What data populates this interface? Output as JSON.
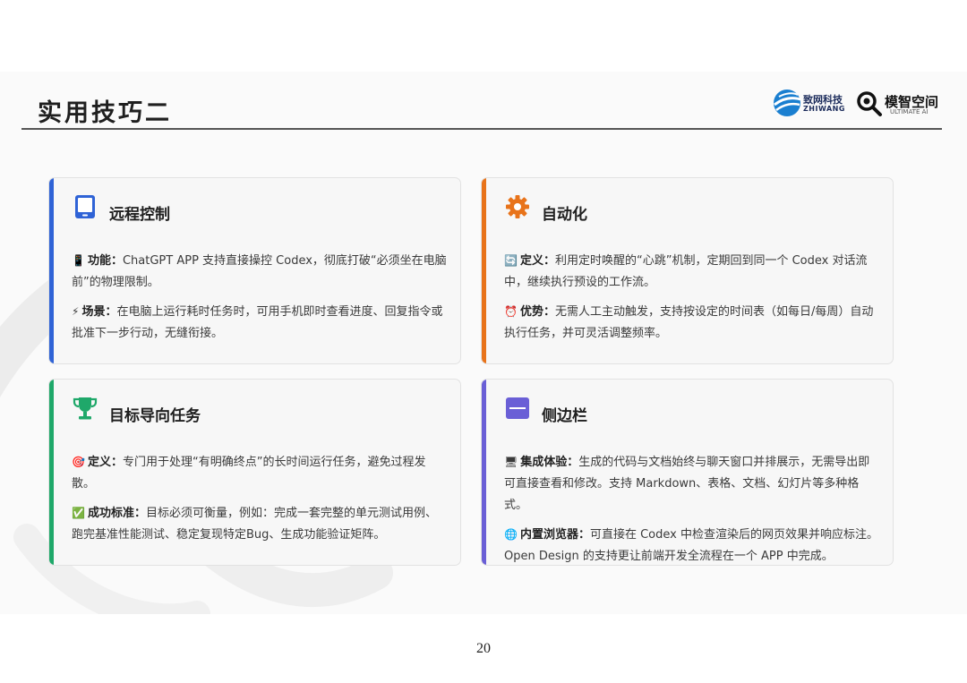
{
  "title": "实用技巧二",
  "logos": {
    "zhiwang_cn": "致网科技",
    "zhiwang_en": "ZHIWANG",
    "mozhi_cn": "模智空间",
    "mozhi_en": "ULTIMATE AI"
  },
  "colors": {
    "blue": "#2f63d6",
    "orange": "#e8731a",
    "green": "#1fa86a",
    "purple": "#6a5fd6"
  },
  "cards": [
    {
      "title": "远程控制",
      "icon": "tablet-icon",
      "accent": "#2f63d6",
      "items": [
        {
          "emoji": "📱",
          "label": "功能：",
          "text": "ChatGPT APP 支持直接操控 Codex，彻底打破“必须坐在电脑前”的物理限制。"
        },
        {
          "emoji": "⚡",
          "label": "场景：",
          "text": "在电脑上运行耗时任务时，可用手机即时查看进度、回复指令或批准下一步行动，无缝衔接。"
        }
      ]
    },
    {
      "title": "自动化",
      "icon": "gear-icon",
      "accent": "#e8731a",
      "items": [
        {
          "emoji": "🔄",
          "label": "定义：",
          "text": "利用定时唤醒的“心跳”机制，定期回到同一个 Codex 对话流中，继续执行预设的工作流。"
        },
        {
          "emoji": "⏰",
          "label": "优势：",
          "text": "无需人工主动触发，支持按设定的时间表（如每日/每周）自动执行任务，并可灵活调整频率。"
        }
      ]
    },
    {
      "title": "目标导向任务",
      "icon": "trophy-icon",
      "accent": "#1fa86a",
      "items": [
        {
          "emoji": "🎯",
          "label": "定义：",
          "text": "专门用于处理“有明确终点”的长时间运行任务，避免过程发散。"
        },
        {
          "emoji": "✅",
          "label": "成功标准：",
          "text": "目标必须可衡量，例如：完成一套完整的单元测试用例、跑完基准性能测试、稳定复现特定Bug、生成功能验证矩阵。"
        }
      ]
    },
    {
      "title": "侧边栏",
      "icon": "sidebar-icon",
      "accent": "#6a5fd6",
      "items": [
        {
          "emoji": "🖥",
          "label": "集成体验：",
          "text": "生成的代码与文档始终与聊天窗口并排展示，无需导出即可直接查看和修改。支持 Markdown、表格、文档、幻灯片等多种格式。"
        },
        {
          "emoji": "🌐",
          "label": "内置浏览器：",
          "text": "可直接在 Codex 中检查渲染后的网页效果并响应标注。Open Design 的支持更让前端开发全流程在一个 APP 中完成。"
        }
      ]
    }
  ],
  "page_number": "20"
}
